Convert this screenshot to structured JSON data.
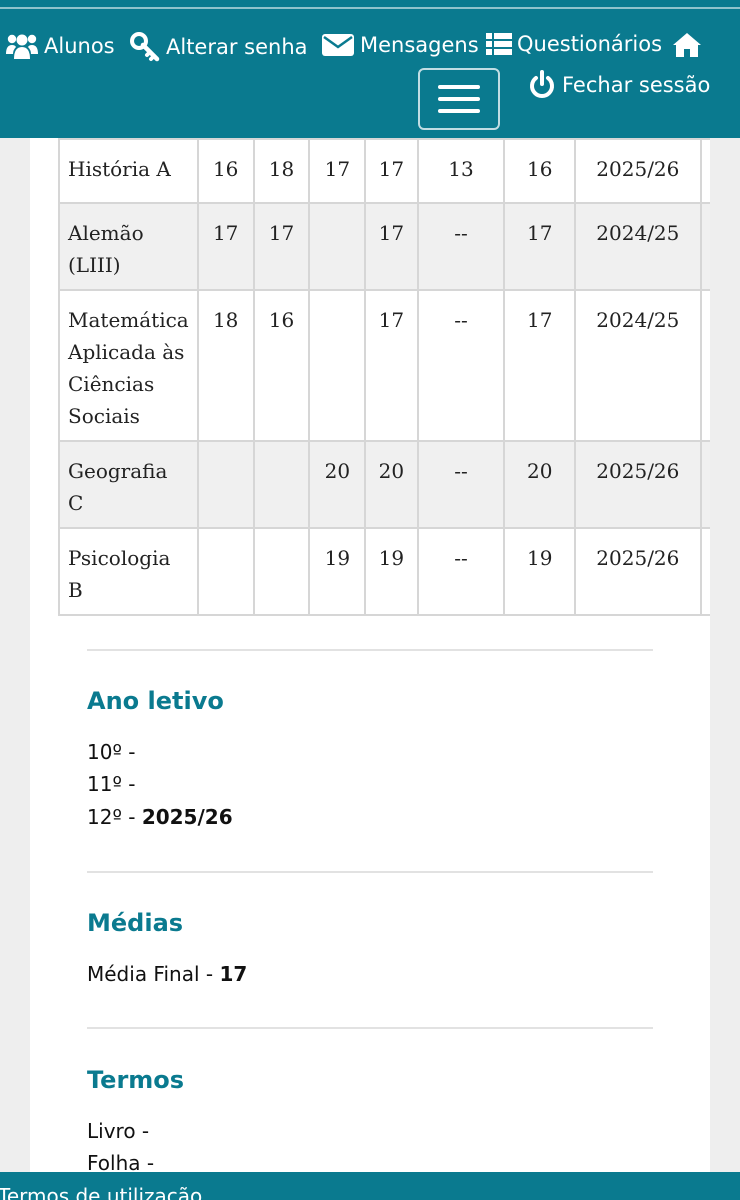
{
  "nav": {
    "alunos": "Alunos",
    "alterar_senha": "Alterar senha",
    "mensagens": "Mensagens",
    "questionarios": "Questionários",
    "fechar_sessao": "Fechar sessão",
    "icons": [
      "users-icon",
      "key-icon",
      "envelope-icon",
      "list-icon",
      "home-icon",
      "power-icon",
      "menu-toggle-icon"
    ],
    "color": "#0a7a8f"
  },
  "grades": {
    "rows": [
      {
        "subject": "História A",
        "cells": [
          "16",
          "18",
          "17",
          "17",
          "13",
          "16",
          "2025/26"
        ]
      },
      {
        "subject": "Alemão (LIII)",
        "cells": [
          "17",
          "17",
          "",
          "17",
          "--",
          "17",
          "2024/25"
        ]
      },
      {
        "subject": "Matemática Aplicada às Ciências Sociais",
        "cells": [
          "18",
          "16",
          "",
          "17",
          "--",
          "17",
          "2024/25"
        ]
      },
      {
        "subject": "Geografia C",
        "cells": [
          "",
          "",
          "20",
          "20",
          "--",
          "20",
          "2025/26"
        ]
      },
      {
        "subject": "Psicologia B",
        "cells": [
          "",
          "",
          "19",
          "19",
          "--",
          "19",
          "2025/26"
        ]
      }
    ]
  },
  "ano_letivo": {
    "title": "Ano letivo",
    "lines": [
      {
        "label": "10º -",
        "value": ""
      },
      {
        "label": "11º -",
        "value": ""
      },
      {
        "label": "12º -",
        "value": "2025/26"
      }
    ]
  },
  "medias": {
    "title": "Médias",
    "label": "Média Final -",
    "value": "17"
  },
  "termos": {
    "title": "Termos",
    "lines": [
      {
        "label": "Livro -",
        "value": ""
      },
      {
        "label": "Folha -",
        "value": ""
      }
    ]
  },
  "footer": {
    "link": "Termos de utilização"
  }
}
